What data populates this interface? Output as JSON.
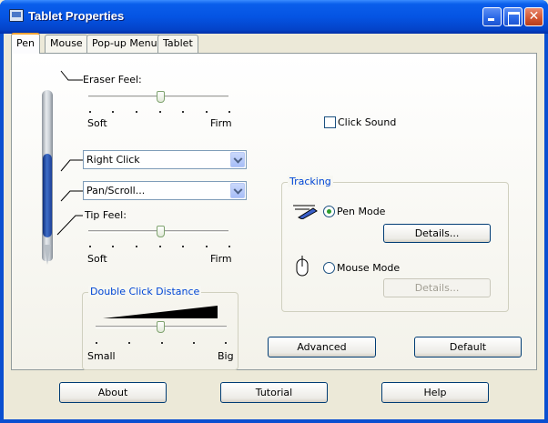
{
  "window": {
    "title": "Tablet Properties",
    "controls": {
      "minimize": "_",
      "maximize": "□",
      "close": "✕"
    }
  },
  "tabs": [
    {
      "label": "Pen",
      "active": true
    },
    {
      "label": "Mouse",
      "active": false
    },
    {
      "label": "Pop-up Menu",
      "active": false
    },
    {
      "label": "Tablet",
      "active": false
    }
  ],
  "pen_tab": {
    "eraser_feel": {
      "label": "Eraser Feel:",
      "min_label": "Soft",
      "max_label": "Firm",
      "value_fraction": 0.5
    },
    "click_sound": {
      "label": "Click Sound",
      "checked": false
    },
    "side_switch_upper": {
      "value": "Right Click"
    },
    "side_switch_lower": {
      "value": "Pan/Scroll..."
    },
    "tip_feel": {
      "label": "Tip Feel:",
      "min_label": "Soft",
      "max_label": "Firm",
      "value_fraction": 0.5
    },
    "double_click_distance": {
      "title": "Double Click Distance",
      "min_label": "Small",
      "max_label": "Big",
      "value_fraction": 0.5
    },
    "tracking": {
      "title": "Tracking",
      "pen_mode": {
        "label": "Pen Mode",
        "selected": true,
        "details_label": "Details...",
        "icon": "pen-tracking-icon"
      },
      "mouse_mode": {
        "label": "Mouse Mode",
        "selected": false,
        "details_label": "Details...",
        "icon": "mouse-icon"
      }
    },
    "advanced_label": "Advanced",
    "default_label": "Default"
  },
  "bottom_buttons": {
    "about": "About",
    "tutorial": "Tutorial",
    "help": "Help"
  },
  "colors": {
    "titlebar": "#0554E3",
    "group_title": "#0046D5",
    "active_tab_accent": "#F5A436",
    "face": "#ECE9D8"
  }
}
